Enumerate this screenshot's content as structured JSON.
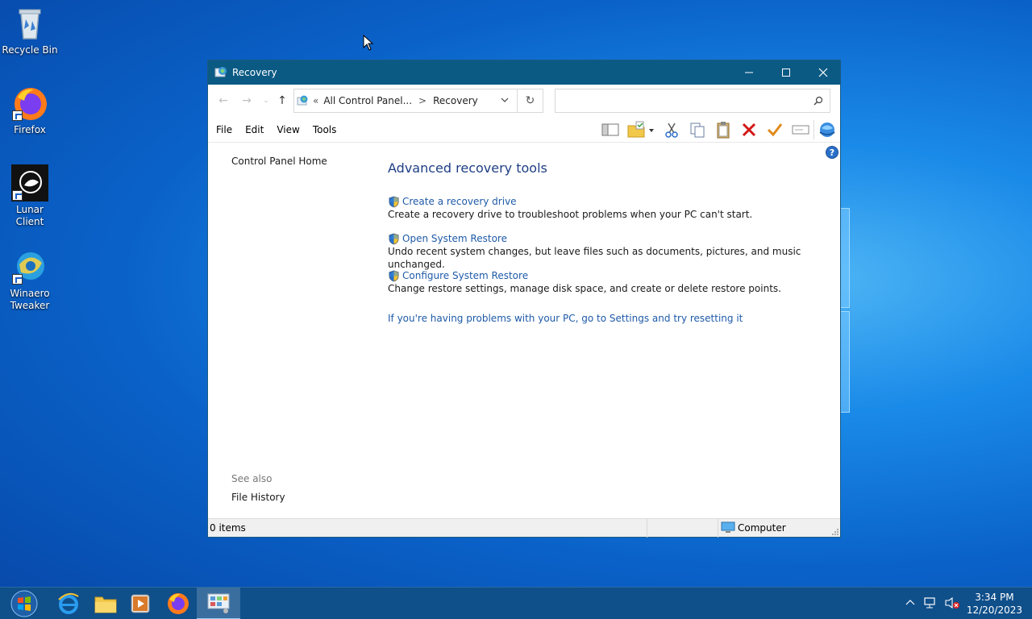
{
  "desktop": {
    "icons": [
      {
        "label": "Recycle Bin"
      },
      {
        "label": "Firefox"
      },
      {
        "label": "Lunar Client"
      },
      {
        "label": "Winaero Tweaker"
      }
    ]
  },
  "window": {
    "title": "Recovery",
    "address": {
      "overflow": "«",
      "crumb1": "All Control Panel...",
      "separator": ">",
      "crumb2": "Recovery"
    },
    "search": {
      "placeholder": ""
    },
    "menu": [
      "File",
      "Edit",
      "View",
      "Tools"
    ],
    "left_pane": {
      "home": "Control Panel Home",
      "see_also_label": "See also",
      "see_also_items": [
        "File History"
      ]
    },
    "main": {
      "title": "Advanced recovery tools",
      "tools": [
        {
          "link": "Create a recovery drive",
          "desc": "Create a recovery drive to troubleshoot problems when your PC can't start."
        },
        {
          "link": "Open System Restore",
          "desc": "Undo recent system changes, but leave files such as documents, pictures, and music unchanged."
        },
        {
          "link": "Configure System Restore",
          "desc": "Change restore settings, manage disk space, and create or delete restore points."
        }
      ],
      "reset_link": "If you're having problems with your PC, go to Settings and try resetting it"
    },
    "status": {
      "items": "0 items",
      "location": "Computer"
    }
  },
  "taskbar": {
    "time": "3:34 PM",
    "date": "12/20/2023"
  },
  "colors": {
    "titlebar": "#0b5a84",
    "link": "#1e5aa8",
    "heading": "#1e3e84",
    "taskbar": "#0f4f8a"
  }
}
